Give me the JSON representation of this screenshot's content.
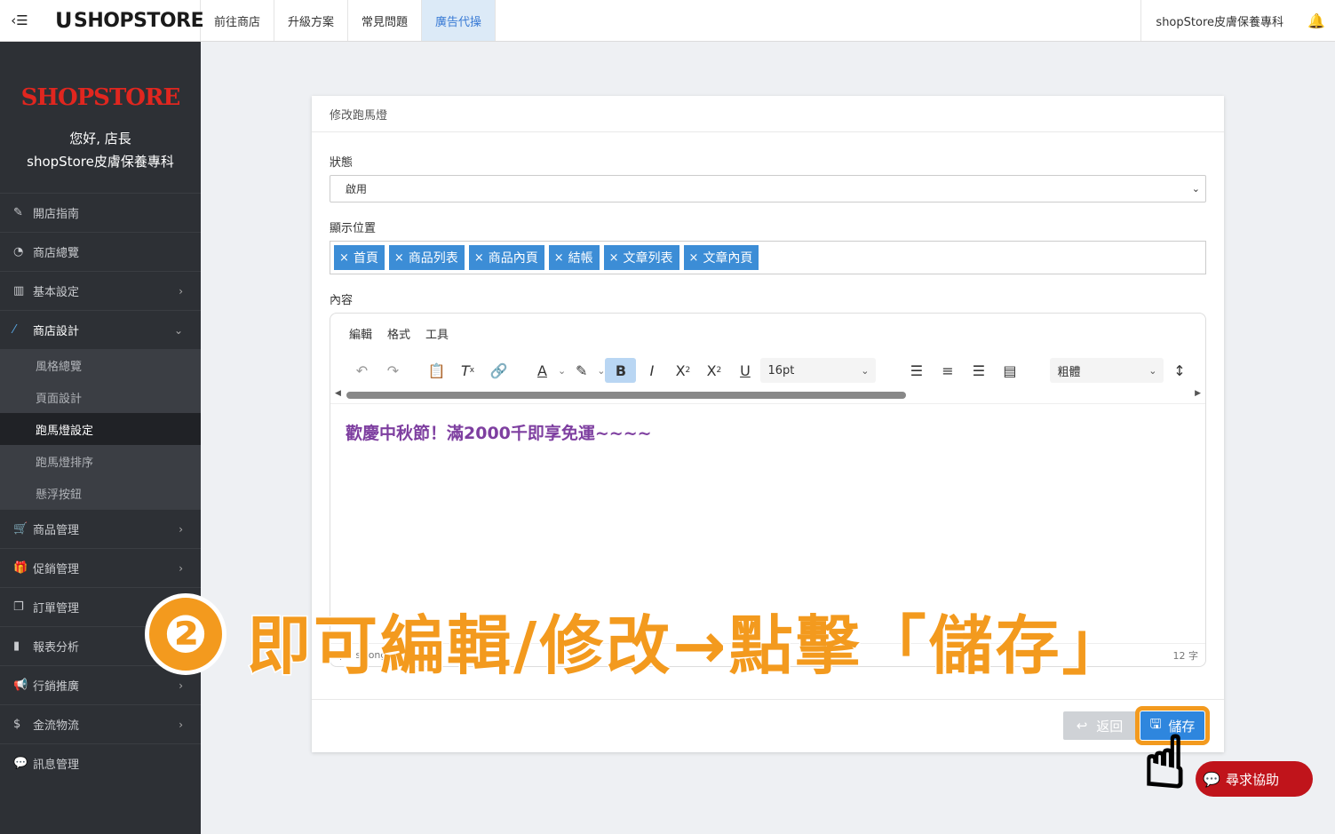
{
  "topbar": {
    "brand": "SHOPSTORE",
    "nav": [
      "前往商店",
      "升級方案",
      "常見問題",
      "廣告代操"
    ],
    "active_nav": "廣告代操",
    "store_name": "shopStore皮膚保養專科"
  },
  "sidebar": {
    "logo": "SHOPSTORE",
    "greeting": "您好, 店長",
    "store": "shopStore皮膚保養專科",
    "items": [
      {
        "label": "開店指南",
        "icon": "wrench-icon"
      },
      {
        "label": "商店總覽",
        "icon": "dashboard-icon"
      },
      {
        "label": "基本設定",
        "icon": "bank-icon"
      },
      {
        "label": "商店設計",
        "icon": "magic-wand-icon"
      },
      {
        "label": "商品管理",
        "icon": "cart-icon"
      },
      {
        "label": "促銷管理",
        "icon": "gift-icon"
      },
      {
        "label": "訂單管理",
        "icon": "copy-icon"
      },
      {
        "label": "報表分析",
        "icon": "bar-chart-icon"
      },
      {
        "label": "行銷推廣",
        "icon": "megaphone-icon"
      },
      {
        "label": "金流物流",
        "icon": "dollar-icon"
      },
      {
        "label": "訊息管理",
        "icon": "chat-icon"
      }
    ],
    "sub_items": [
      "風格總覽",
      "頁面設計",
      "跑馬燈設定",
      "跑馬燈排序",
      "懸浮按鈕"
    ],
    "active_sub": "跑馬燈設定"
  },
  "form": {
    "title": "修改跑馬燈",
    "status_label": "狀態",
    "status_value": "啟用",
    "position_label": "顯示位置",
    "positions": [
      "首頁",
      "商品列表",
      "商品內頁",
      "結帳",
      "文章列表",
      "文章內頁"
    ],
    "content_label": "內容"
  },
  "editor": {
    "menus": [
      "編輯",
      "格式",
      "工具"
    ],
    "font_size": "16pt",
    "font_weight": "粗體",
    "content": "歡慶中秋節！滿2000千即享免運~~~~",
    "status_path": "p › strong",
    "word_count": "12 字"
  },
  "buttons": {
    "back": "返回",
    "save": "儲存"
  },
  "annotation": {
    "step": "❷",
    "text": "即可編輯/修改→點擊「儲存」"
  },
  "help": {
    "label": "尋求協助"
  }
}
